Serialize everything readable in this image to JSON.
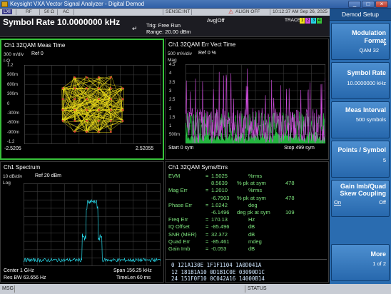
{
  "window": {
    "title": "Keysight VXA Vector Signal Analyzer - Digital Demod",
    "minimize": "_",
    "maximize": "□",
    "close": "×"
  },
  "status_strip": {
    "lxi": "LXI",
    "rf": "RF",
    "impedance": "50 Ω",
    "coupling": "AC",
    "sense": "SENSE:INT",
    "align": "ALIGN OFF",
    "datetime": "10:12:37 AM Sep 26, 2025"
  },
  "header": {
    "symbol_rate": "Symbol Rate 10.0000000 kHz",
    "trig": "Trig: Free Run",
    "range": "Range: 20.00 dBm",
    "avg": "Avg|Off",
    "trace_label": "TRACE",
    "traces": [
      "1",
      "2",
      "3",
      "4"
    ]
  },
  "panels": {
    "meas_time": {
      "title": "Ch1 32QAM Meas Time",
      "scale": "300 m/div",
      "ref": "Ref 0",
      "axis_name": "I-Q",
      "y_ticks": [
        "1.2",
        "900m",
        "600m",
        "300m",
        "0",
        "-300m",
        "-600m",
        "-900m",
        "-1.2"
      ],
      "x_left": "-2.5205",
      "x_right": "2.52055"
    },
    "err_vect": {
      "title": "Ch1 32QAM Err Vect Time",
      "scale": "500 m%/div",
      "ref": "Ref 0 %",
      "axis_name": "Mag",
      "y_ticks": [
        "4.5",
        "4",
        "3.5",
        "3",
        "2.5",
        "2",
        "1.5",
        "1",
        "500m"
      ],
      "x_left": "Start 0  sym",
      "x_right": "Stop 499  sym"
    },
    "spectrum": {
      "title": "Ch1 Spectrum",
      "scale": "10 dB/div",
      "ref": "Ref 20 dBm",
      "axis_name": "Log",
      "center": "Center 1 GHz",
      "span": "Span 156.25 kHz",
      "res_bw": "Res BW 63.656  Hz",
      "time_len": "TimeLen 60 ms"
    },
    "syms_errs": {
      "title": "Ch1 32QAM Syms/Errs",
      "rows": [
        {
          "name": "EVM",
          "eq": "=",
          "value": "1.5025",
          "unit": "%rms",
          "extra": "",
          "sym": ""
        },
        {
          "name": "",
          "eq": "",
          "value": "8.5639",
          "unit": "% pk  at   sym",
          "extra": "478",
          "sym": ""
        },
        {
          "name": "Mag Err",
          "eq": "=",
          "value": "1.2010",
          "unit": "%rms",
          "extra": "",
          "sym": ""
        },
        {
          "name": "",
          "eq": "",
          "value": "-6.7903",
          "unit": "% pk  at   sym",
          "extra": "478",
          "sym": ""
        },
        {
          "name": "Phase Err",
          "eq": "=",
          "value": "1.0242",
          "unit": "deg",
          "extra": "",
          "sym": ""
        },
        {
          "name": "",
          "eq": "",
          "value": "-6.1496",
          "unit": "deg  pk  at   sym",
          "extra": "109",
          "sym": ""
        },
        {
          "name": "Freq Err",
          "eq": "=",
          "value": "170.13",
          "unit": "Hz",
          "extra": "",
          "sym": ""
        },
        {
          "name": "IQ Offset",
          "eq": "=",
          "value": "-85.496",
          "unit": "dB",
          "extra": "",
          "sym": ""
        },
        {
          "name": "SNR (MER)",
          "eq": "=",
          "value": "32.372",
          "unit": "dB",
          "extra": "",
          "sym": ""
        },
        {
          "name": "Quad Err",
          "eq": "=",
          "value": "-85.461",
          "unit": "mdeg",
          "extra": "",
          "sym": ""
        },
        {
          "name": "Gain Imb",
          "eq": "=",
          "value": "-0.053",
          "unit": "dB",
          "extra": "",
          "sym": ""
        }
      ],
      "symbols": [
        "0    121A130E  1F1F1104  1A0D041A",
        "12   181B1A10  0D1B1C0E  03090D1C",
        "24   151F0F10  0C042A16  14000B14"
      ]
    }
  },
  "softkeys": {
    "header": "Demod Setup",
    "keys": [
      {
        "label": "Modulation Format",
        "arrow": "▸",
        "value": "QAM 32"
      },
      {
        "label": "Symbol Rate",
        "value": "10.0000000 kHz"
      },
      {
        "label": "Meas Interval",
        "value": "500 symbols"
      },
      {
        "label": "Points / Symbol",
        "value": "5"
      },
      {
        "label": "Gain Imb/Quad Skew Coupling",
        "on": "On",
        "off": "Off"
      },
      {
        "label": "More",
        "value": "1 of 2"
      }
    ]
  },
  "bottom_bar": {
    "msg": "MSG",
    "status": "STATUS"
  },
  "colors": {
    "grid_active_border": "#37c23a",
    "iq_trace": "#f2e21a",
    "iq_points": "#e23a3a",
    "err_primary": "#d14fe0",
    "err_secondary": "#2ad64a",
    "spectrum": "#27d6e6"
  }
}
